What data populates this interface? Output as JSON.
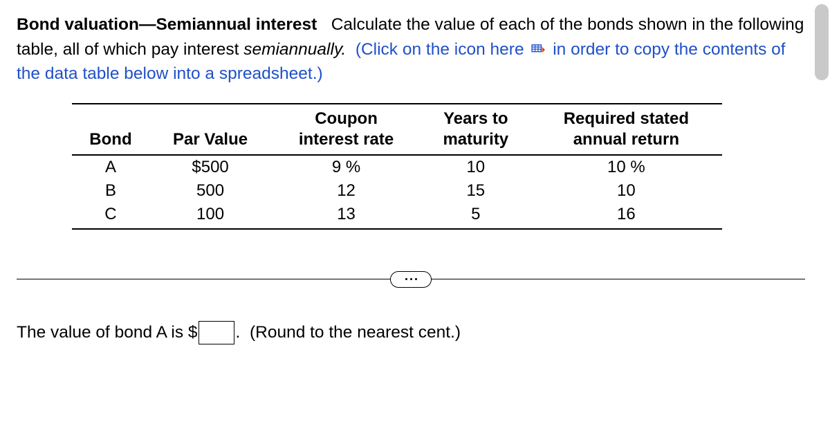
{
  "prompt": {
    "title_bold": "Bond valuation—Semiannual interest",
    "lead": "Calculate the value of each of the bonds shown in the following table, all of which pay interest ",
    "italic_word": "semiannually.",
    "blue_before_icon": "(Click on the icon here",
    "blue_after_icon": "in order to copy the contents of the data table below into a spreadsheet.)"
  },
  "table": {
    "headers": {
      "bond": "Bond",
      "par": "Par Value",
      "coupon_l1": "Coupon",
      "coupon_l2": "interest rate",
      "years_l1": "Years to",
      "years_l2": "maturity",
      "req_l1": "Required stated",
      "req_l2": "annual return"
    },
    "rows": [
      {
        "bond": "A",
        "par": "$500",
        "coupon": "9 %",
        "years": "10",
        "req": "10 %"
      },
      {
        "bond": "B",
        "par": "500",
        "coupon": "12",
        "years": "15",
        "req": "10"
      },
      {
        "bond": "C",
        "par": "100",
        "coupon": "13",
        "years": "5",
        "req": "16"
      }
    ]
  },
  "answer": {
    "before": "The value of bond A is $",
    "after_input": ".",
    "hint": "(Round to the nearest cent.)",
    "value": ""
  },
  "chart_data": {
    "type": "table",
    "columns": [
      "Bond",
      "Par Value",
      "Coupon interest rate",
      "Years to maturity",
      "Required stated annual return"
    ],
    "rows": [
      [
        "A",
        500,
        "9%",
        10,
        "10%"
      ],
      [
        "B",
        500,
        "12",
        15,
        "10"
      ],
      [
        "C",
        100,
        "13",
        5,
        "16"
      ]
    ]
  }
}
